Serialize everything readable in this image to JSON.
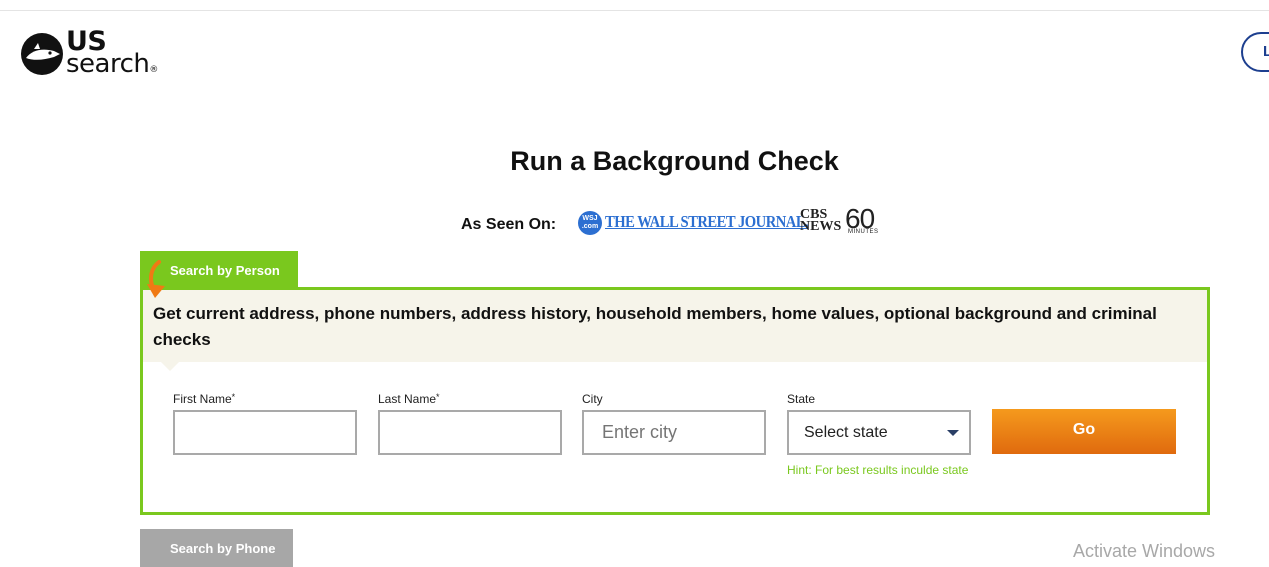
{
  "header": {
    "logo_us": "US",
    "logo_search": "search",
    "logo_reg": "®",
    "login_label": "L"
  },
  "hero": {
    "title": "Run a Background Check",
    "as_seen_on": "As Seen On:",
    "press": {
      "wsj_badge": "WSJ .com",
      "wsj_name": "THE WALL STREET JOURNAL.",
      "cbs_line1": "CBS",
      "cbs_line2": "NEWS",
      "sixty": "60",
      "sixty_sub": "MINUTES"
    }
  },
  "search_person": {
    "tab_label": "Search by Person",
    "description": "Get current address, phone numbers, address history, household members, home values, optional background and criminal checks",
    "fields": {
      "first_name": {
        "label": "First Name",
        "required_mark": "*",
        "value": "",
        "placeholder": ""
      },
      "last_name": {
        "label": "Last Name",
        "required_mark": "*",
        "value": "",
        "placeholder": ""
      },
      "city": {
        "label": "City",
        "value": "",
        "placeholder": "Enter city"
      },
      "state": {
        "label": "State",
        "selected": "Select state",
        "hint": "Hint: For best results inculde state"
      }
    },
    "go_label": "Go"
  },
  "search_phone": {
    "tab_label": "Search by Phone"
  },
  "os_overlay": {
    "watermark": "Activate Windows"
  },
  "colors": {
    "brand_green": "#7ac81e",
    "go_orange": "#f08a1a",
    "link_blue": "#1d3f8f",
    "band_bg": "#f6f4ea",
    "inactive_tab": "#a7a7a7"
  }
}
